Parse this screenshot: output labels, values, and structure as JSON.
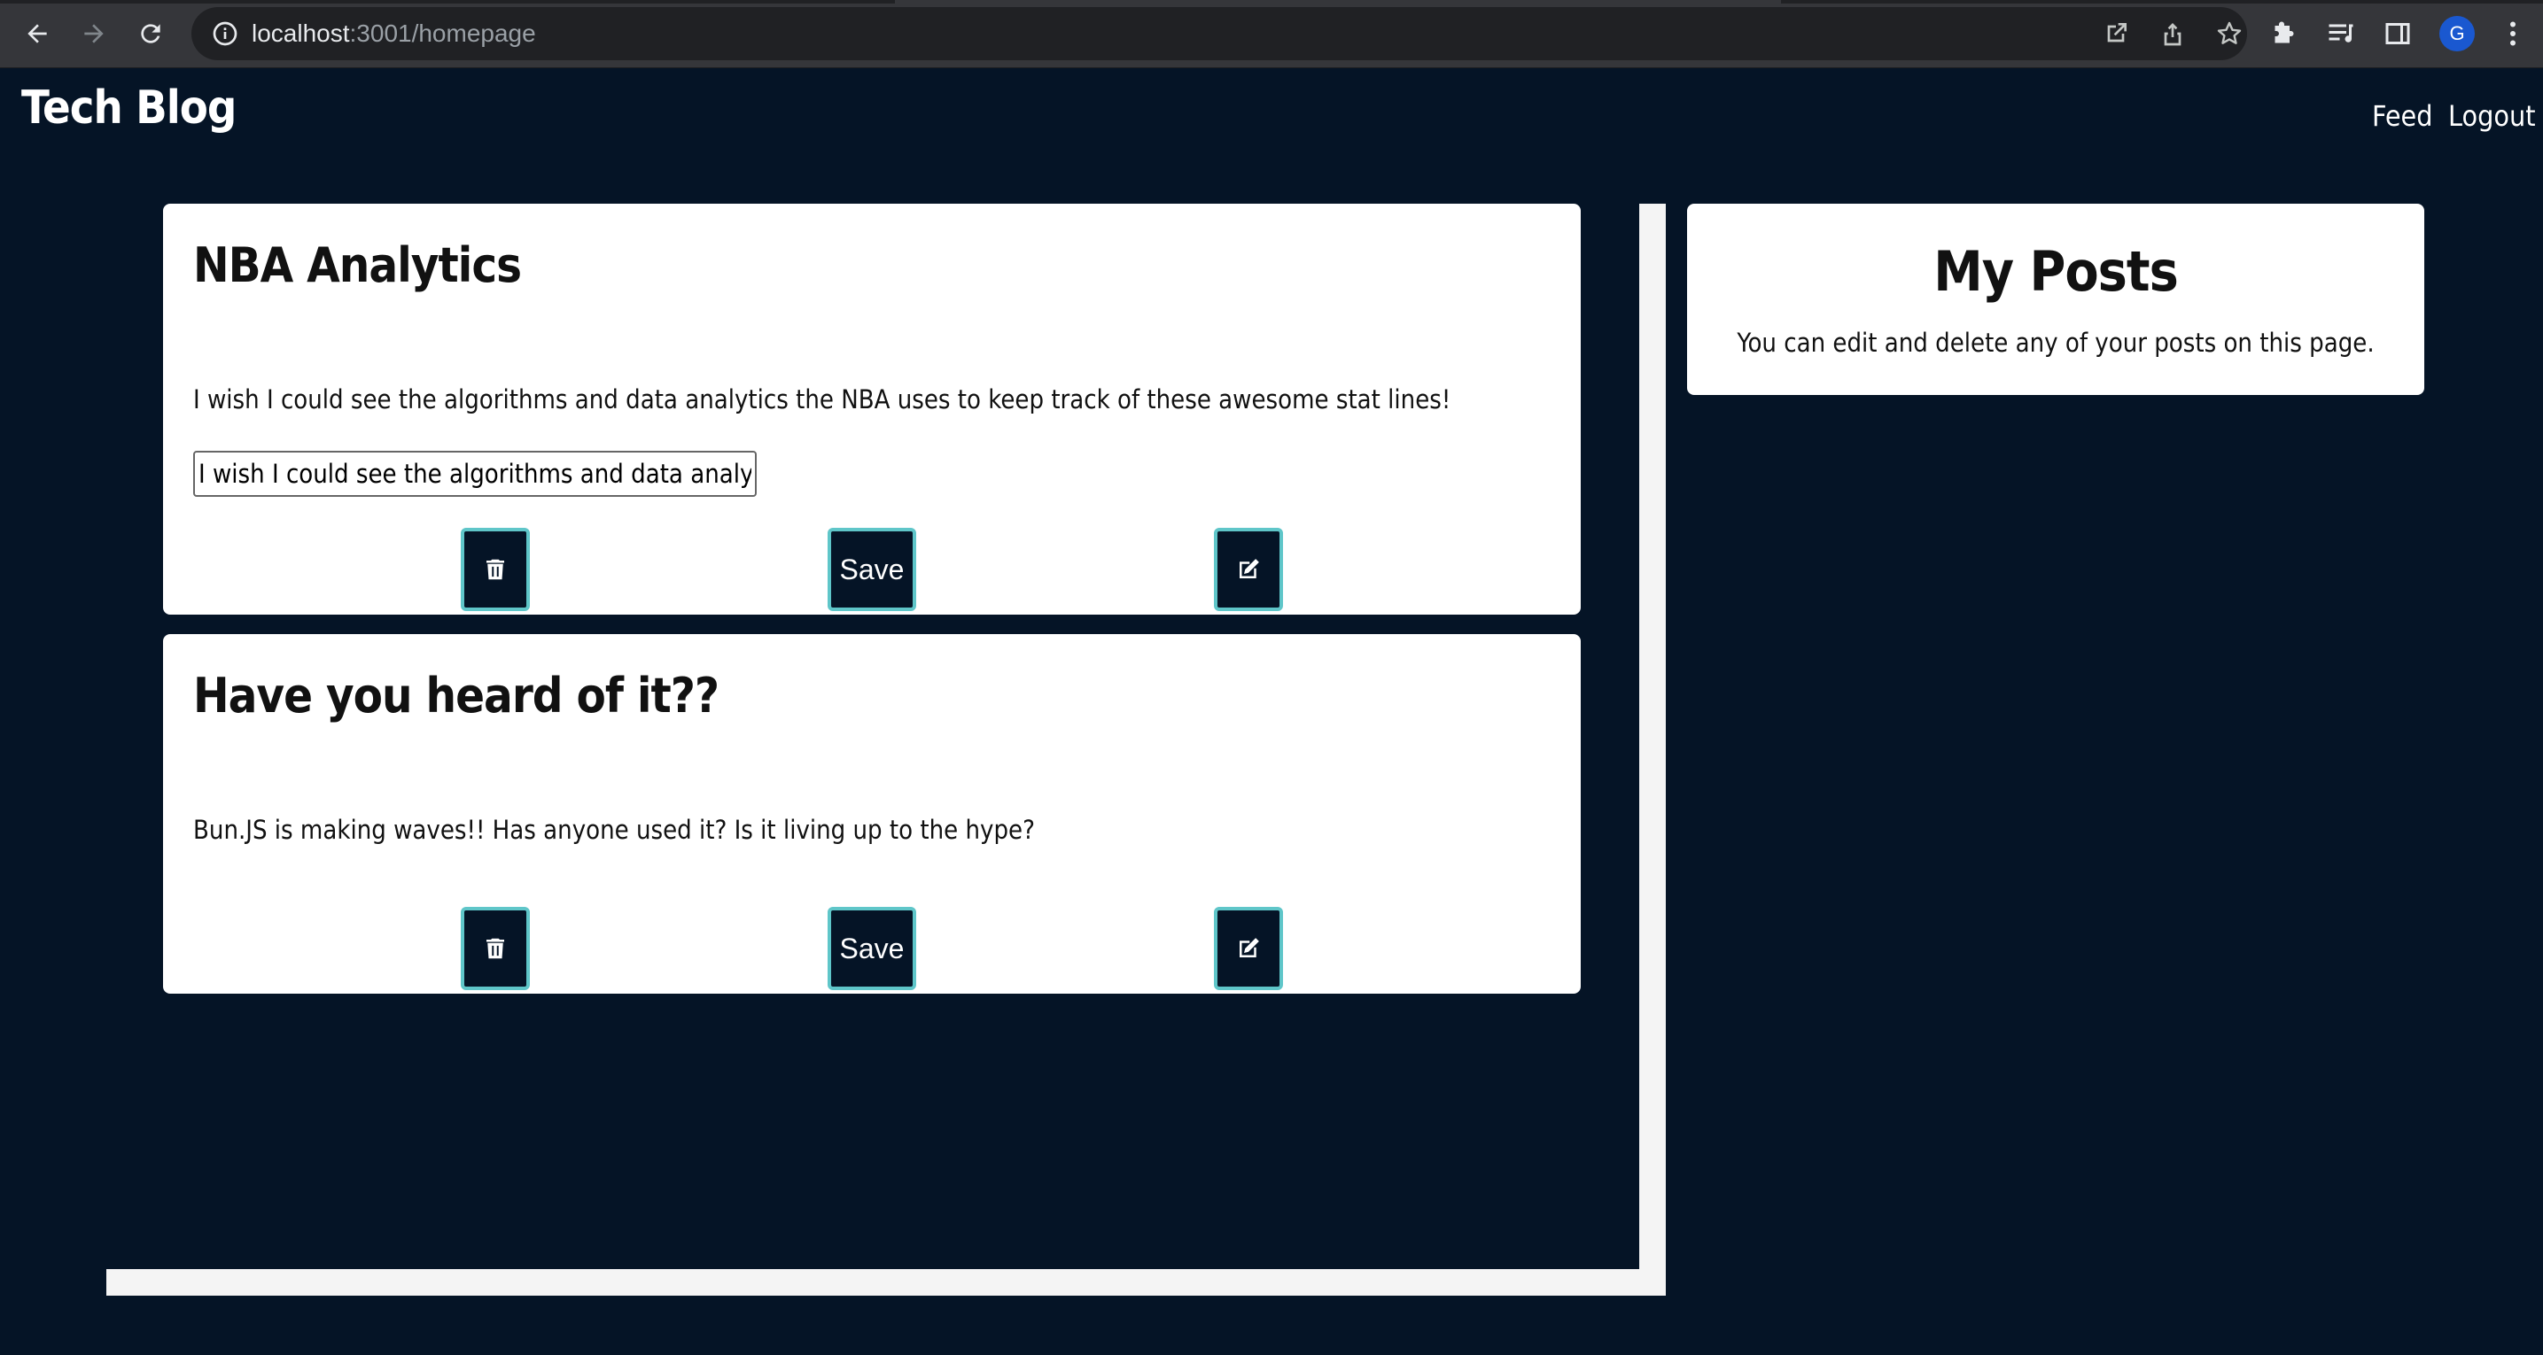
{
  "browser": {
    "url_host": "localhost",
    "url_path": ":3001/homepage",
    "profile_initial": "G"
  },
  "header": {
    "brand": "Tech Blog",
    "nav": [
      "Feed",
      "Logout"
    ]
  },
  "posts": [
    {
      "title": "NBA Analytics",
      "body": "I wish I could see the algorithms and data analytics the NBA uses to keep track of these awesome stat lines!",
      "edit_value": "I wish I could see the algorithms and data analytics the NBA uses to keep track of these awesome stat lines!",
      "save_label": "Save"
    },
    {
      "title": "Have you heard of it??",
      "body": "Bun.JS is making waves!! Has anyone used it? Is it living up to the hype?",
      "save_label": "Save"
    }
  ],
  "sidebar": {
    "title": "My Posts",
    "text": "You can edit and delete any of your posts on this page."
  },
  "colors": {
    "page_background": "#051426",
    "button_border": "#5fc6c9",
    "card_background": "#ffffff"
  }
}
